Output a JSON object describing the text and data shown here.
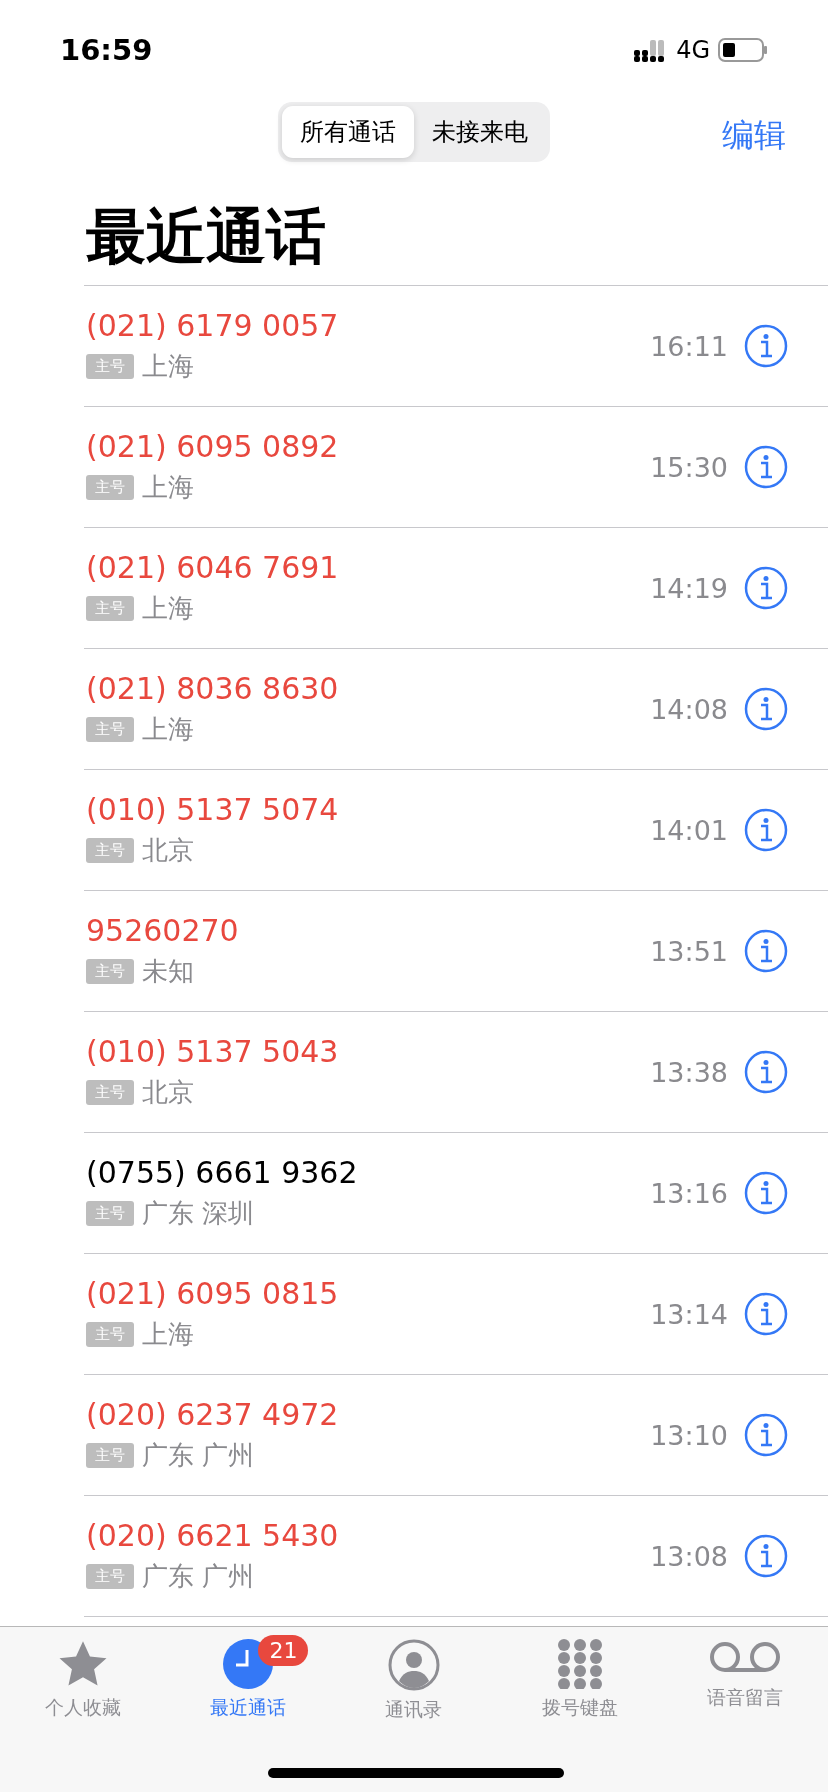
{
  "status_bar": {
    "time": "16:59",
    "network": "4G"
  },
  "segments": [
    {
      "label": "所有通话",
      "selected": true
    },
    {
      "label": "未接来电",
      "selected": false
    }
  ],
  "edit_button": "编辑",
  "title": "最近通话",
  "calls": [
    {
      "number": "(021) 6179 0057",
      "tag": "主号",
      "location": "上海",
      "time": "16:11",
      "missed": true
    },
    {
      "number": "(021) 6095 0892",
      "tag": "主号",
      "location": "上海",
      "time": "15:30",
      "missed": true
    },
    {
      "number": "(021) 6046 7691",
      "tag": "主号",
      "location": "上海",
      "time": "14:19",
      "missed": true
    },
    {
      "number": "(021) 8036 8630",
      "tag": "主号",
      "location": "上海",
      "time": "14:08",
      "missed": true
    },
    {
      "number": "(010) 5137 5074",
      "tag": "主号",
      "location": "北京",
      "time": "14:01",
      "missed": true
    },
    {
      "number": "95260270",
      "tag": "主号",
      "location": "未知",
      "time": "13:51",
      "missed": true
    },
    {
      "number": "(010) 5137 5043",
      "tag": "主号",
      "location": "北京",
      "time": "13:38",
      "missed": true
    },
    {
      "number": "(0755) 6661 9362",
      "tag": "主号",
      "location": "广东 深圳",
      "time": "13:16",
      "missed": false
    },
    {
      "number": "(021) 6095 0815",
      "tag": "主号",
      "location": "上海",
      "time": "13:14",
      "missed": true
    },
    {
      "number": "(020) 6237 4972",
      "tag": "主号",
      "location": "广东 广州",
      "time": "13:10",
      "missed": true
    },
    {
      "number": "(020) 6621 5430",
      "tag": "主号",
      "location": "广东 广州",
      "time": "13:08",
      "missed": true
    }
  ],
  "tab_bar": [
    {
      "kind": "favorites",
      "label": "个人收藏",
      "selected": false
    },
    {
      "kind": "recents",
      "label": "最近通话",
      "selected": true,
      "badge": "21"
    },
    {
      "kind": "contacts",
      "label": "通讯录",
      "selected": false
    },
    {
      "kind": "keypad",
      "label": "拨号键盘",
      "selected": false
    },
    {
      "kind": "voicemail",
      "label": "语音留言",
      "selected": false
    }
  ]
}
